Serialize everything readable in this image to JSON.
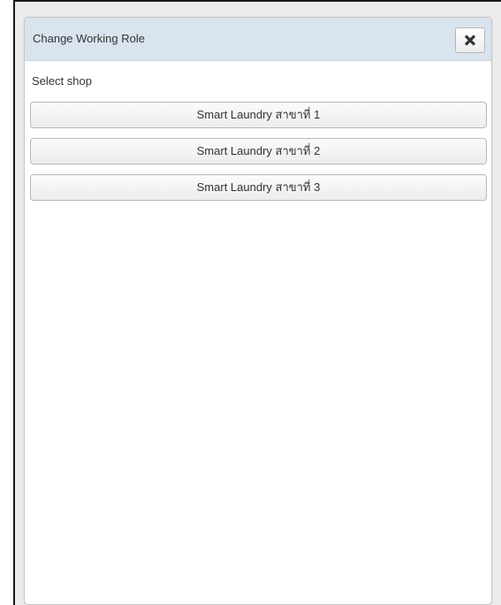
{
  "dialog": {
    "title": "Change Working Role",
    "close_icon": "close-icon"
  },
  "select_shop": {
    "label": "Select shop",
    "shops": [
      {
        "label": "Smart Laundry สาขาที่ 1"
      },
      {
        "label": "Smart Laundry สาขาที่ 2"
      },
      {
        "label": "Smart Laundry สาขาที่ 3"
      }
    ]
  },
  "colors": {
    "header_bg": "#d9e4ef",
    "dialog_bg": "#ffffff",
    "button_border": "#b8b8b8",
    "text": "#333333"
  }
}
